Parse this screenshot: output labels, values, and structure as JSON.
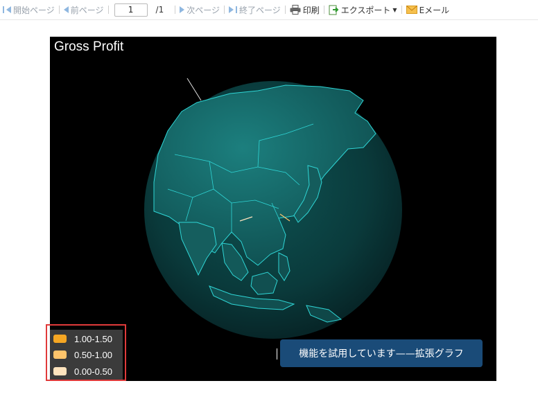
{
  "toolbar": {
    "first_page": "開始ページ",
    "prev_page": "前ページ",
    "page_number": "1",
    "page_total": "/1",
    "next_page": "次ページ",
    "last_page": "終了ページ",
    "print": "印刷",
    "export": "エクスポート",
    "email": "Eメール"
  },
  "chart": {
    "title": "Gross Profit",
    "trial_banner": "機能を試用しています——拡張グラフ",
    "background": "#000000",
    "globe_color": "#0f4b4b",
    "border_color": "#2fd6d6"
  },
  "legend": {
    "items": [
      {
        "label": "1.00-1.50",
        "color": "#f5a623"
      },
      {
        "label": "0.50-1.00",
        "color": "#ffc46b"
      },
      {
        "label": "0.00-0.50",
        "color": "#fde3bd"
      }
    ]
  }
}
